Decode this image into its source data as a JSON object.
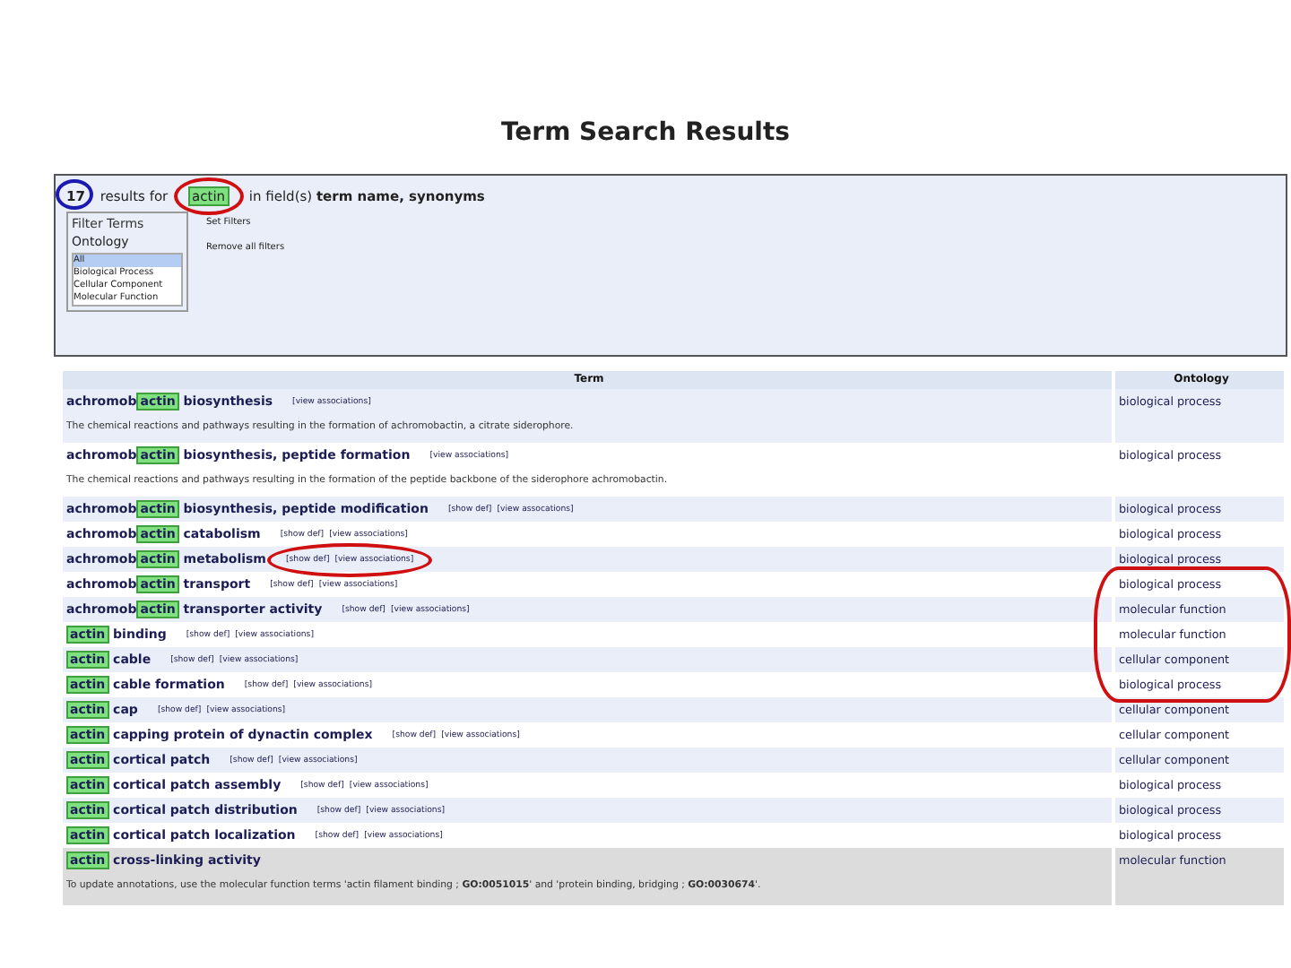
{
  "page_title": "Term Search Results",
  "summary": {
    "count": "17",
    "text_1": " results for ",
    "query": "actin",
    "text_2": " in field(s) ",
    "fields": "term name, synonyms"
  },
  "filter": {
    "legend": "Filter Terms",
    "label": "Ontology",
    "options": [
      {
        "label": "All",
        "selected": true
      },
      {
        "label": "Biological Process",
        "selected": false
      },
      {
        "label": "Cellular Component",
        "selected": false
      },
      {
        "label": "Molecular Function",
        "selected": false
      }
    ],
    "set_filters": "Set Filters",
    "remove_filters": "Remove all filters"
  },
  "table": {
    "columns": [
      "Term",
      "Ontology"
    ],
    "rows": [
      {
        "before": "achromob",
        "match": "actin",
        "after": " biosynthesis",
        "links": [
          "[view associations]"
        ],
        "definition": "The chemical reactions and pathways resulting in the formation of achromobactin, a citrate siderophore.",
        "ontology": "biological process",
        "obsolete": false
      },
      {
        "before": "achromob",
        "match": "actin",
        "after": " biosynthesis, peptide formation",
        "links": [
          "[view associations]"
        ],
        "definition": "The chemical reactions and pathways resulting in the formation of the peptide backbone of the siderophore achromobactin.",
        "ontology": "biological process",
        "obsolete": false
      },
      {
        "before": "achromob",
        "match": "actin",
        "after": " biosynthesis, peptide modification",
        "links": [
          "[show def]",
          "[view assocations]"
        ],
        "ontology": "biological process",
        "obsolete": false
      },
      {
        "before": "achromob",
        "match": "actin",
        "after": " catabolism",
        "links": [
          "[show def]",
          "[view associations]"
        ],
        "ontology": "biological process",
        "obsolete": false
      },
      {
        "before": "achromob",
        "match": "actin",
        "after": " metabolism",
        "links": [
          "[show def]",
          "[view associations]"
        ],
        "ontology": "biological process",
        "obsolete": false
      },
      {
        "before": "achromob",
        "match": "actin",
        "after": " transport",
        "links": [
          "[show def]",
          "[view associations]"
        ],
        "ontology": "biological process",
        "obsolete": false
      },
      {
        "before": "achromob",
        "match": "actin",
        "after": " transporter activity",
        "links": [
          "[show def]",
          "[view associations]"
        ],
        "ontology": "molecular function",
        "obsolete": false
      },
      {
        "before": "",
        "match": "actin",
        "after": " binding",
        "links": [
          "[show def]",
          "[view associations]"
        ],
        "ontology": "molecular function",
        "obsolete": false
      },
      {
        "before": "",
        "match": "actin",
        "after": " cable",
        "links": [
          "[show def]",
          "[view associations]"
        ],
        "ontology": "cellular component",
        "obsolete": false
      },
      {
        "before": "",
        "match": "actin",
        "after": " cable formation",
        "links": [
          "[show def]",
          "[view associations]"
        ],
        "ontology": "biological process",
        "obsolete": false
      },
      {
        "before": "",
        "match": "actin",
        "after": " cap",
        "links": [
          "[show def]",
          "[view associations]"
        ],
        "ontology": "cellular component",
        "obsolete": false
      },
      {
        "before": "",
        "match": "actin",
        "after": " capping protein of dynactin complex",
        "links": [
          "[show def]",
          "[view associations]"
        ],
        "ontology": "cellular component",
        "obsolete": false
      },
      {
        "before": "",
        "match": "actin",
        "after": " cortical patch",
        "links": [
          "[show def]",
          "[view associations]"
        ],
        "ontology": "cellular component",
        "obsolete": false
      },
      {
        "before": "",
        "match": "actin",
        "after": " cortical patch assembly",
        "links": [
          "[show def]",
          "[view associations]"
        ],
        "ontology": "biological process",
        "obsolete": false
      },
      {
        "before": "",
        "match": "actin",
        "after": " cortical patch distribution",
        "links": [
          "[show def]",
          "[view associations]"
        ],
        "ontology": "biological process",
        "obsolete": false
      },
      {
        "before": "",
        "match": "actin",
        "after": " cortical patch localization",
        "links": [
          "[show def]",
          "[view associations]"
        ],
        "ontology": "biological process",
        "obsolete": false
      },
      {
        "before": "",
        "match": "actin",
        "after": " cross-linking activity",
        "links": [],
        "definition": "To update annotations, use the molecular function terms 'actin filament binding ; **GO:0051015**' and 'protein binding, bridging ; **GO:0030674**'.",
        "ontology": "molecular function",
        "obsolete": true
      }
    ]
  },
  "annotations": [
    {
      "color": "#1a1ab0"
    },
    {
      "color": "#d01010"
    },
    {
      "color": "#d01010"
    },
    {
      "color": "#d01010"
    }
  ]
}
